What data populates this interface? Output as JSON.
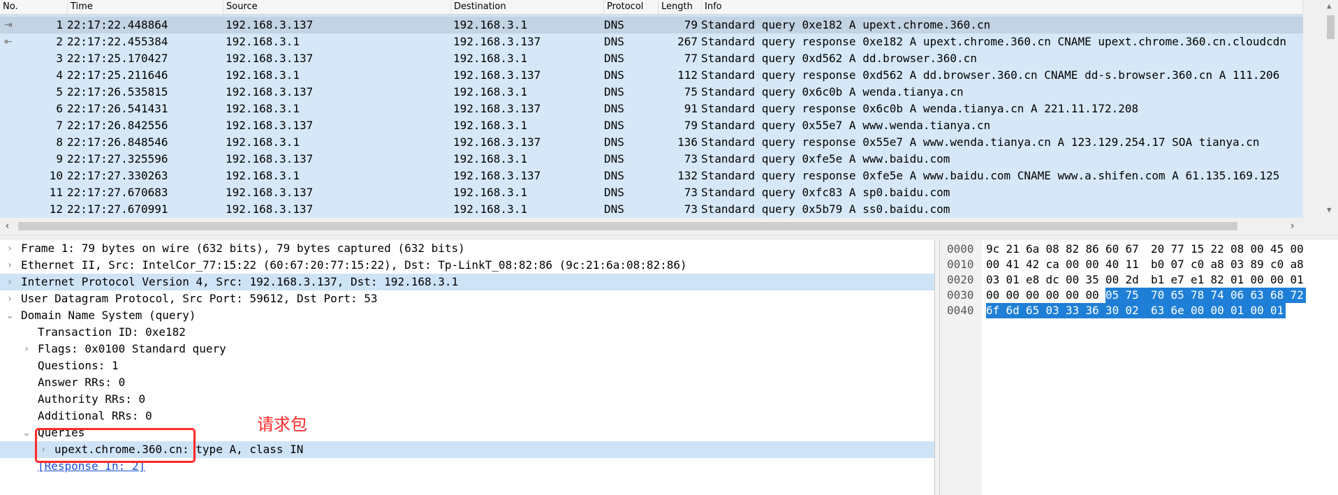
{
  "packet_list": {
    "columns": [
      {
        "label": "No."
      },
      {
        "label": "Time"
      },
      {
        "label": "Source"
      },
      {
        "label": "Destination"
      },
      {
        "label": "Protocol"
      },
      {
        "label": "Length"
      },
      {
        "label": "Info"
      }
    ],
    "rows": [
      {
        "no": "1",
        "time": "22:17:22.448864",
        "source": "192.168.3.137",
        "destination": "192.168.3.1",
        "protocol": "DNS",
        "length": "79",
        "info": "Standard query 0xe182 A upext.chrome.360.cn",
        "selected": true
      },
      {
        "no": "2",
        "time": "22:17:22.455384",
        "source": "192.168.3.1",
        "destination": "192.168.3.137",
        "protocol": "DNS",
        "length": "267",
        "info": "Standard query response 0xe182 A upext.chrome.360.cn CNAME upext.chrome.360.cn.cloudcdn",
        "selected": false
      },
      {
        "no": "3",
        "time": "22:17:25.170427",
        "source": "192.168.3.137",
        "destination": "192.168.3.1",
        "protocol": "DNS",
        "length": "77",
        "info": "Standard query 0xd562 A dd.browser.360.cn",
        "selected": false
      },
      {
        "no": "4",
        "time": "22:17:25.211646",
        "source": "192.168.3.1",
        "destination": "192.168.3.137",
        "protocol": "DNS",
        "length": "112",
        "info": "Standard query response 0xd562 A dd.browser.360.cn CNAME dd-s.browser.360.cn A 111.206",
        "selected": false
      },
      {
        "no": "5",
        "time": "22:17:26.535815",
        "source": "192.168.3.137",
        "destination": "192.168.3.1",
        "protocol": "DNS",
        "length": "75",
        "info": "Standard query 0x6c0b A wenda.tianya.cn",
        "selected": false
      },
      {
        "no": "6",
        "time": "22:17:26.541431",
        "source": "192.168.3.1",
        "destination": "192.168.3.137",
        "protocol": "DNS",
        "length": "91",
        "info": "Standard query response 0x6c0b A wenda.tianya.cn A 221.11.172.208",
        "selected": false
      },
      {
        "no": "7",
        "time": "22:17:26.842556",
        "source": "192.168.3.137",
        "destination": "192.168.3.1",
        "protocol": "DNS",
        "length": "79",
        "info": "Standard query 0x55e7 A www.wenda.tianya.cn",
        "selected": false
      },
      {
        "no": "8",
        "time": "22:17:26.848546",
        "source": "192.168.3.1",
        "destination": "192.168.3.137",
        "protocol": "DNS",
        "length": "136",
        "info": "Standard query response 0x55e7 A www.wenda.tianya.cn A 123.129.254.17 SOA tianya.cn",
        "selected": false
      },
      {
        "no": "9",
        "time": "22:17:27.325596",
        "source": "192.168.3.137",
        "destination": "192.168.3.1",
        "protocol": "DNS",
        "length": "73",
        "info": "Standard query 0xfe5e A www.baidu.com",
        "selected": false
      },
      {
        "no": "10",
        "time": "22:17:27.330263",
        "source": "192.168.3.1",
        "destination": "192.168.3.137",
        "protocol": "DNS",
        "length": "132",
        "info": "Standard query response 0xfe5e A www.baidu.com CNAME www.a.shifen.com A 61.135.169.125",
        "selected": false
      },
      {
        "no": "11",
        "time": "22:17:27.670683",
        "source": "192.168.3.137",
        "destination": "192.168.3.1",
        "protocol": "DNS",
        "length": "73",
        "info": "Standard query 0xfc83 A sp0.baidu.com",
        "selected": false
      },
      {
        "no": "12",
        "time": "22:17:27.670991",
        "source": "192.168.3.137",
        "destination": "192.168.3.1",
        "protocol": "DNS",
        "length": "73",
        "info": "Standard query 0x5b79 A ss0.baidu.com",
        "selected": false
      }
    ]
  },
  "details": [
    {
      "text": "Frame 1: 79 bytes on wire (632 bits), 79 bytes captured (632 bits)",
      "depth": 0,
      "twisty": "›",
      "highlight": false,
      "link": false
    },
    {
      "text": "Ethernet II, Src: IntelCor_77:15:22 (60:67:20:77:15:22), Dst: Tp-LinkT_08:82:86 (9c:21:6a:08:82:86)",
      "depth": 0,
      "twisty": "›",
      "highlight": false,
      "link": false
    },
    {
      "text": "Internet Protocol Version 4, Src: 192.168.3.137, Dst: 192.168.3.1",
      "depth": 0,
      "twisty": "›",
      "highlight": true,
      "link": false
    },
    {
      "text": "User Datagram Protocol, Src Port: 59612, Dst Port: 53",
      "depth": 0,
      "twisty": "›",
      "highlight": false,
      "link": false
    },
    {
      "text": "Domain Name System (query)",
      "depth": 0,
      "twisty": "⌄",
      "highlight": false,
      "link": false
    },
    {
      "text": "Transaction ID: 0xe182",
      "depth": 1,
      "twisty": "",
      "highlight": false,
      "link": false
    },
    {
      "text": "Flags: 0x0100 Standard query",
      "depth": 1,
      "twisty": "›",
      "highlight": false,
      "link": false
    },
    {
      "text": "Questions: 1",
      "depth": 1,
      "twisty": "",
      "highlight": false,
      "link": false
    },
    {
      "text": "Answer RRs: 0",
      "depth": 1,
      "twisty": "",
      "highlight": false,
      "link": false
    },
    {
      "text": "Authority RRs: 0",
      "depth": 1,
      "twisty": "",
      "highlight": false,
      "link": false
    },
    {
      "text": "Additional RRs: 0",
      "depth": 1,
      "twisty": "",
      "highlight": false,
      "link": false
    },
    {
      "text": "Queries",
      "depth": 1,
      "twisty": "⌄",
      "highlight": false,
      "link": false
    },
    {
      "text": "upext.chrome.360.cn: type A, class IN",
      "depth": 2,
      "twisty": "›",
      "highlight": true,
      "link": false
    },
    {
      "text": "[Response In: 2]",
      "depth": 1,
      "twisty": "",
      "highlight": false,
      "link": true
    }
  ],
  "hex": {
    "rows": [
      {
        "offset": "0000",
        "bytes": [
          "9c",
          "21",
          "6a",
          "08",
          "82",
          "86",
          "60",
          "67",
          "20",
          "77",
          "15",
          "22",
          "08",
          "00",
          "45",
          "00"
        ],
        "sel_from": 16
      },
      {
        "offset": "0010",
        "bytes": [
          "00",
          "41",
          "42",
          "ca",
          "00",
          "00",
          "40",
          "11",
          "b0",
          "07",
          "c0",
          "a8",
          "03",
          "89",
          "c0",
          "a8"
        ],
        "sel_from": 16
      },
      {
        "offset": "0020",
        "bytes": [
          "03",
          "01",
          "e8",
          "dc",
          "00",
          "35",
          "00",
          "2d",
          "b1",
          "e7",
          "e1",
          "82",
          "01",
          "00",
          "00",
          "01"
        ],
        "sel_from": 16
      },
      {
        "offset": "0030",
        "bytes": [
          "00",
          "00",
          "00",
          "00",
          "00",
          "00",
          "05",
          "75",
          "70",
          "65",
          "78",
          "74",
          "06",
          "63",
          "68",
          "72"
        ],
        "sel_from": 6
      },
      {
        "offset": "0040",
        "bytes": [
          "6f",
          "6d",
          "65",
          "03",
          "33",
          "36",
          "30",
          "02",
          "63",
          "6e",
          "00",
          "00",
          "01",
          "00",
          "01"
        ],
        "sel_from": 0
      }
    ]
  },
  "annotation": {
    "label": "请求包",
    "color": "#ff2a2a"
  },
  "colors": {
    "row_bg": "#d6e8f8",
    "row_selected": "#c2d3e3",
    "hex_selected": "#1f7fd6"
  }
}
